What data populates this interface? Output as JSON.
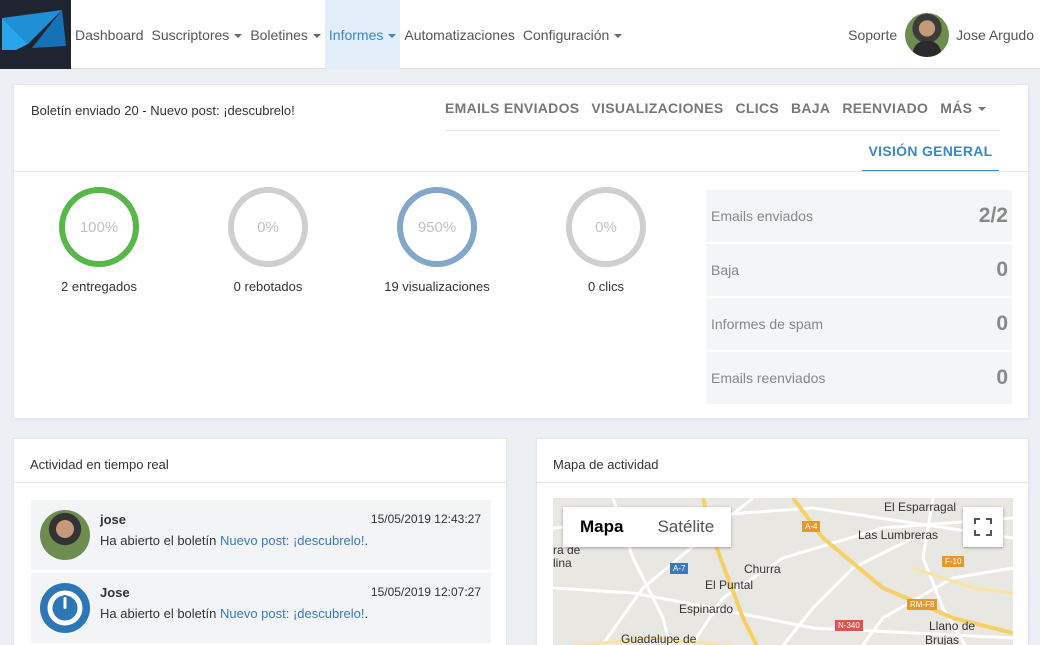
{
  "nav": {
    "items": [
      {
        "label": "Dashboard",
        "caret": false,
        "active": false
      },
      {
        "label": "Suscriptores",
        "caret": true,
        "active": false
      },
      {
        "label": "Boletines",
        "caret": true,
        "active": false
      },
      {
        "label": "Informes",
        "caret": true,
        "active": true
      },
      {
        "label": "Automatizaciones",
        "caret": false,
        "active": false
      },
      {
        "label": "Configuración",
        "caret": true,
        "active": false
      }
    ],
    "support": "Soporte",
    "user_name": "Jose Argudo"
  },
  "report": {
    "title": "Boletín enviado 20 - Nuevo post: ¡descubrelo!",
    "tabs": [
      "EMAILS ENVIADOS",
      "VISUALIZACIONES",
      "CLICS",
      "BAJA",
      "REENVIADO"
    ],
    "more_tab": "MÁS",
    "active_tab": "VISIÓN GENERAL",
    "metrics": [
      {
        "percent": "100%",
        "label": "2 entregados",
        "ring": "green"
      },
      {
        "percent": "0%",
        "label": "0 rebotados",
        "ring": "gray"
      },
      {
        "percent": "950%",
        "label": "19 visualizaciones",
        "ring": "blue"
      },
      {
        "percent": "0%",
        "label": "0 clics",
        "ring": "gray"
      }
    ],
    "stats": [
      {
        "label": "Emails enviados",
        "value": "2/2"
      },
      {
        "label": "Baja",
        "value": "0"
      },
      {
        "label": "Informes de spam",
        "value": "0"
      },
      {
        "label": "Emails reenviados",
        "value": "0"
      }
    ]
  },
  "activity": {
    "title": "Actividad en tiempo real",
    "items": [
      {
        "name": "jose",
        "time": "15/05/2019 12:43:27",
        "text": "Ha abierto el boletín ",
        "link": "Nuevo post: ¡descubrelo!",
        "suffix": ".",
        "avatar": "photo"
      },
      {
        "name": "Jose",
        "time": "15/05/2019 12:07:27",
        "text": "Ha abierto el boletín ",
        "link": "Nuevo post: ¡descubrelo!",
        "suffix": ".",
        "avatar": "power-logo"
      }
    ]
  },
  "map": {
    "title": "Mapa de actividad",
    "btn_map": "Mapa",
    "btn_satellite": "Satélite",
    "labels": [
      "El Esparragal",
      "Las Lumbreras",
      "Churra",
      "El Puntal",
      "Espinardo",
      "Guadalupe de",
      "Llano de",
      "Brujas",
      "ra de",
      "lina"
    ],
    "roads": [
      "A-4",
      "A-7",
      "F-10",
      "RM-F8",
      "N-340"
    ]
  }
}
